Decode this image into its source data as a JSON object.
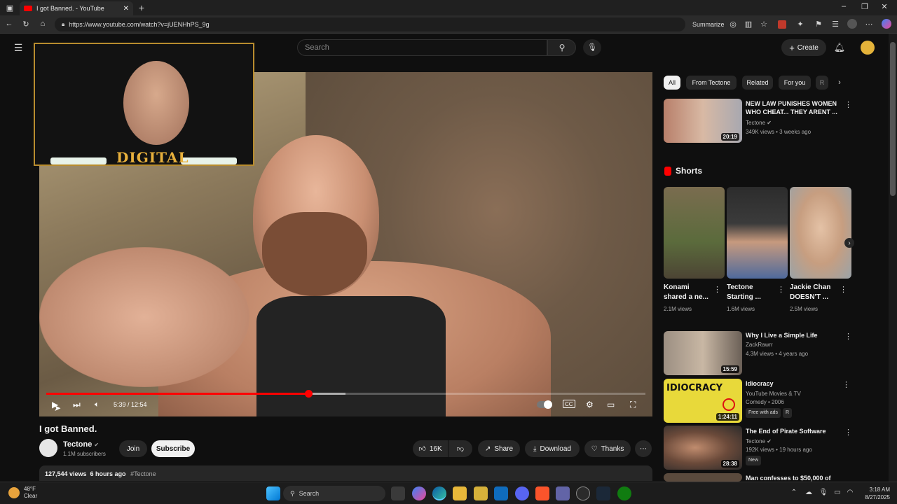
{
  "browser": {
    "tab_title": "I got Banned. - YouTube",
    "url": "https://www.youtube.com/watch?v=jUENHhPS_9g",
    "summarize_label": "Summarize"
  },
  "header": {
    "search_placeholder": "Search",
    "create_label": "Create"
  },
  "player": {
    "overlay_logo": "DIGITAL",
    "time": "5:39 / 12:54",
    "progress_fraction": 0.437,
    "buffer_fraction": 0.5
  },
  "video": {
    "title": "I got Banned.",
    "channel": "Tectone",
    "subscribers": "1.1M subscribers",
    "join_label": "Join",
    "subscribe_label": "Subscribe",
    "likes": "16K",
    "share_label": "Share",
    "download_label": "Download",
    "thanks_label": "Thanks",
    "views_time": "127,544 views  6 hours ago",
    "hashtag": "#Tectone"
  },
  "chips": [
    "All",
    "From Tectone",
    "Related",
    "For you",
    "R"
  ],
  "recommended": [
    {
      "title1": "NEW LAW PUNISHES WOMEN",
      "title2": "WHO CHEAT... THEY ARENT ...",
      "channel": "Tectone",
      "meta": "349K views • 3 weeks ago",
      "duration": "20:19"
    },
    {
      "title1": "Why I Live a Simple Life",
      "title2": "",
      "channel": "ZackRawrr",
      "meta": "4.3M views • 4 years ago",
      "duration": "15:59"
    },
    {
      "title1": "Idiocracy",
      "title2": "",
      "channel": "YouTube Movies & TV",
      "meta": "Comedy • 2006",
      "duration": "1:24:11",
      "badge1": "Free with ads",
      "badge2": "R",
      "thumb_text": "IDIOCRACY"
    },
    {
      "title1": "The End of Pirate Software",
      "title2": "",
      "channel": "Tectone",
      "meta": "192K views • 19 hours ago",
      "duration": "28:38",
      "badge1": "New"
    },
    {
      "title1": "Man confesses to $50,000 of",
      "title2": "",
      "channel": "",
      "meta": "",
      "duration": ""
    }
  ],
  "shorts": {
    "heading": "Shorts",
    "items": [
      {
        "title1": "Konami",
        "title2": "shared a ne...",
        "views": "2.1M views"
      },
      {
        "title1": "Tectone",
        "title2": "Starting ...",
        "views": "1.6M views"
      },
      {
        "title1": "Jackie Chan",
        "title2": "DOESN'T ...",
        "views": "2.5M views"
      }
    ]
  },
  "taskbar": {
    "temp": "48°F",
    "condition": "Clear",
    "search_label": "Search",
    "time": "3:18 AM",
    "date": "8/27/2025"
  },
  "colors": {
    "accent_red": "#ff0000",
    "bg": "#0f0f0f",
    "chip": "#272727"
  }
}
